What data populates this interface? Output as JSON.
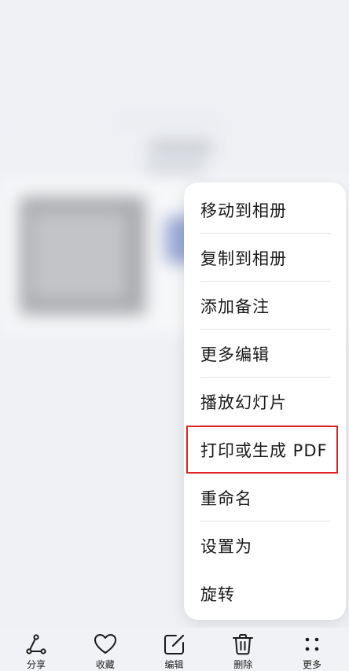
{
  "menu": {
    "items": [
      {
        "label": "移动到相册"
      },
      {
        "label": "复制到相册"
      },
      {
        "label": "添加备注"
      },
      {
        "label": "更多编辑"
      },
      {
        "label": "播放幻灯片"
      },
      {
        "label": "打印或生成 PDF"
      },
      {
        "label": "重命名"
      },
      {
        "label": "设置为"
      },
      {
        "label": "旋转"
      }
    ],
    "highlight_color": "#e02020"
  },
  "toolbar": {
    "share_label": "分享",
    "favorite_label": "收藏",
    "edit_label": "编辑",
    "delete_label": "删除",
    "more_label": "更多"
  }
}
